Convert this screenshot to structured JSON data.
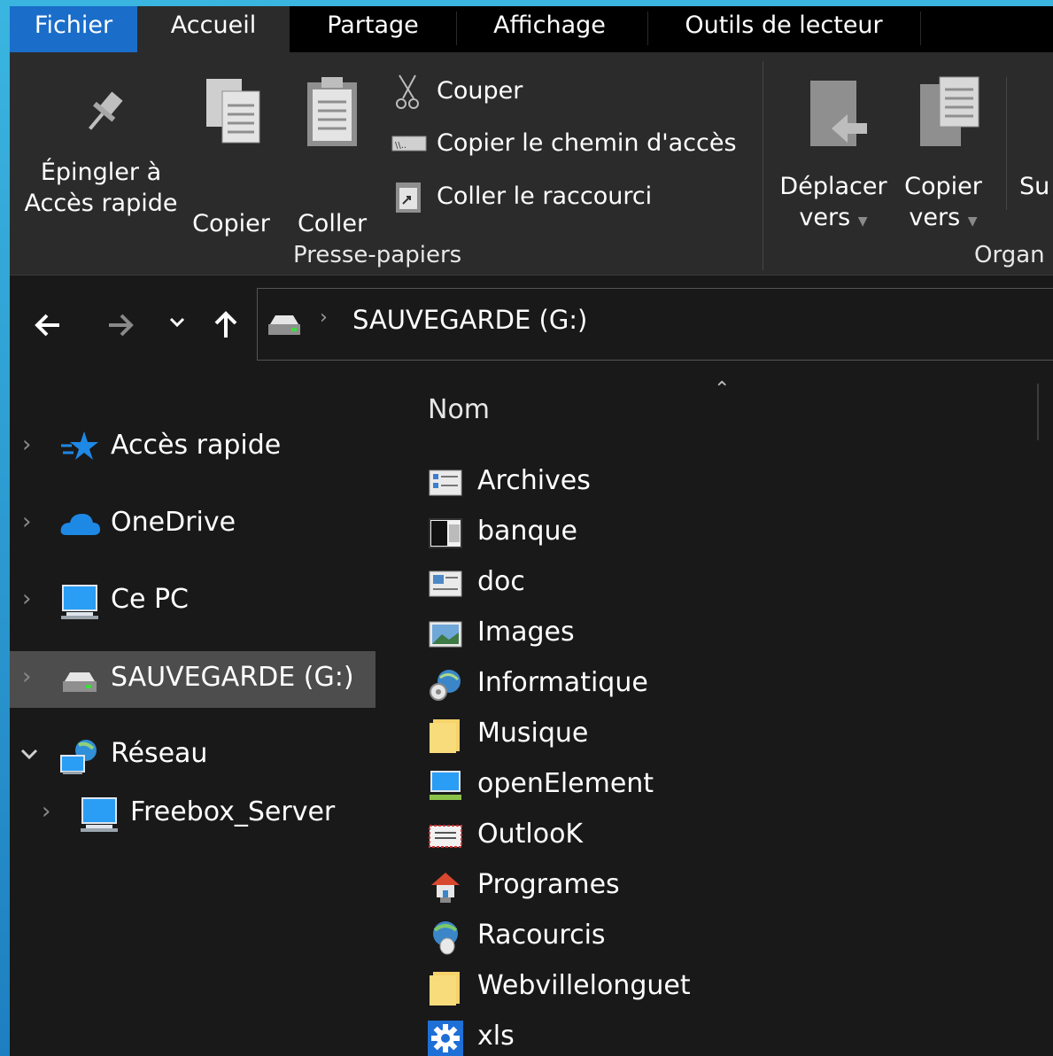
{
  "tabs": [
    {
      "label": "Fichier"
    },
    {
      "label": "Accueil"
    },
    {
      "label": "Partage"
    },
    {
      "label": "Affichage"
    },
    {
      "label": "Outils de lecteur"
    }
  ],
  "ribbon": {
    "pin": {
      "line1": "Épingler à",
      "line2": "Accès rapide"
    },
    "copy": "Copier",
    "paste": "Coller",
    "cut": "Couper",
    "copy_path": "Copier le chemin d'accès",
    "paste_shortcut": "Coller le raccourci",
    "group_clipboard": "Presse-papiers",
    "move_to": {
      "line1": "Déplacer",
      "line2": "vers"
    },
    "copy_to": {
      "line1": "Copier",
      "line2": "vers"
    },
    "delete_partial": "Su",
    "group_organize": "Organ"
  },
  "nav": {
    "back_icon": "arrow-left-icon",
    "forward_icon": "arrow-right-icon",
    "recent_icon": "chevron-down-icon",
    "up_icon": "arrow-up-icon",
    "breadcrumb": "SAUVEGARDE (G:)"
  },
  "tree": {
    "items": [
      {
        "label": "Accès rapide",
        "icon": "star-icon"
      },
      {
        "label": "OneDrive",
        "icon": "cloud-icon"
      },
      {
        "label": "Ce PC",
        "icon": "computer-icon"
      },
      {
        "label": "SAUVEGARDE (G:)",
        "icon": "drive-icon"
      },
      {
        "label": "Réseau",
        "icon": "network-icon"
      },
      {
        "label": "Freebox_Server",
        "icon": "computer-icon"
      }
    ]
  },
  "list": {
    "column_name": "Nom",
    "items": [
      {
        "label": "Archives",
        "icon": "list-icon"
      },
      {
        "label": "banque",
        "icon": "film-icon"
      },
      {
        "label": "doc",
        "icon": "document-icon"
      },
      {
        "label": "Images",
        "icon": "picture-icon"
      },
      {
        "label": "Informatique",
        "icon": "globe-gear-icon"
      },
      {
        "label": "Musique",
        "icon": "folder-icon"
      },
      {
        "label": "openElement",
        "icon": "monitor-icon"
      },
      {
        "label": "OutlooK",
        "icon": "mail-icon"
      },
      {
        "label": "Programes",
        "icon": "house-icon"
      },
      {
        "label": "Racourcis",
        "icon": "globe-mouse-icon"
      },
      {
        "label": "Webvillelonguet",
        "icon": "folder-icon"
      },
      {
        "label": "xls",
        "icon": "gear-icon"
      }
    ]
  },
  "colors": {
    "file_tab": "#1a6dc9",
    "ribbon": "#2b2b2b",
    "background": "#191919",
    "selected": "#4d4d4d",
    "folder": "#f6d36b"
  }
}
